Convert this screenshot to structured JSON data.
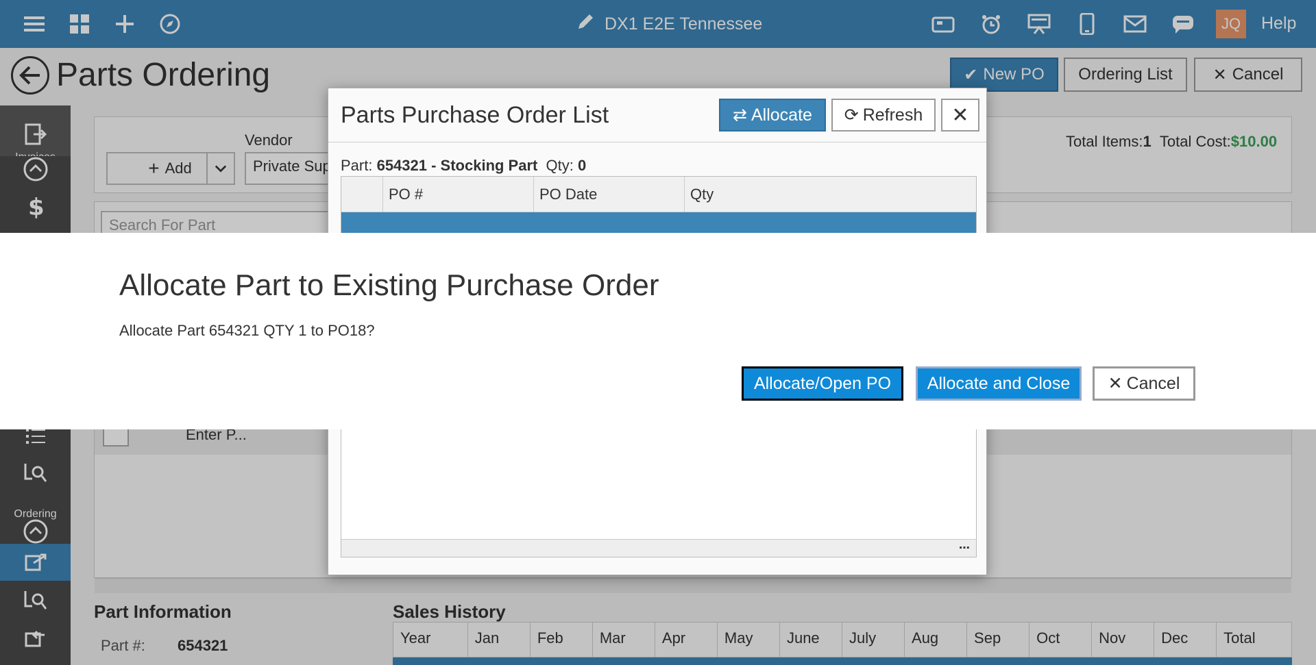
{
  "topbar": {
    "title": "DX1 E2E Tennessee",
    "avatar": "JQ",
    "help": "Help"
  },
  "page": {
    "title": "Parts Ordering",
    "new_po": "New PO",
    "ordering_list": "Ordering List",
    "cancel": "Cancel"
  },
  "sidebar": {
    "invoices": "Invoices",
    "ordering": "Ordering"
  },
  "main": {
    "vendor_label": "Vendor",
    "add_label": "Add",
    "vendor_value": "Private Sup",
    "search_placeholder": "Search For Part",
    "total_items_label": "Total Items:",
    "total_items_value": "1",
    "total_cost_label": "Total Cost:",
    "total_cost_value": "$10.00",
    "row_text": "Enter P...",
    "part_info_title": "Part Information",
    "part_num_label": "Part #:",
    "part_num_value": "654321",
    "sales_history_title": "Sales History",
    "sales_cols": [
      "Year",
      "Jan",
      "Feb",
      "Mar",
      "Apr",
      "May",
      "June",
      "July",
      "Aug",
      "Sep",
      "Oct",
      "Nov",
      "Dec",
      "Total"
    ]
  },
  "po_dialog": {
    "title": "Parts Purchase Order List",
    "allocate": "Allocate",
    "refresh": "Refresh",
    "part_prefix": "Part: ",
    "part_name": "654321 - Stocking Part",
    "qty_label": "Qty: ",
    "qty_value": "0",
    "columns": [
      "PO #",
      "PO Date",
      "Qty"
    ]
  },
  "confirm": {
    "title": "Allocate Part to Existing Purchase Order",
    "message": "Allocate Part 654321 QTY 1 to PO18?",
    "allocate_open": "Allocate/Open PO",
    "allocate_close": "Allocate and Close",
    "cancel": "Cancel"
  },
  "colors": {
    "topbar": "#3d85b6",
    "accent_blue": "#0f8ad8",
    "sidebar": "#4a4a4a",
    "total_cost_green": "#3aa05a"
  }
}
